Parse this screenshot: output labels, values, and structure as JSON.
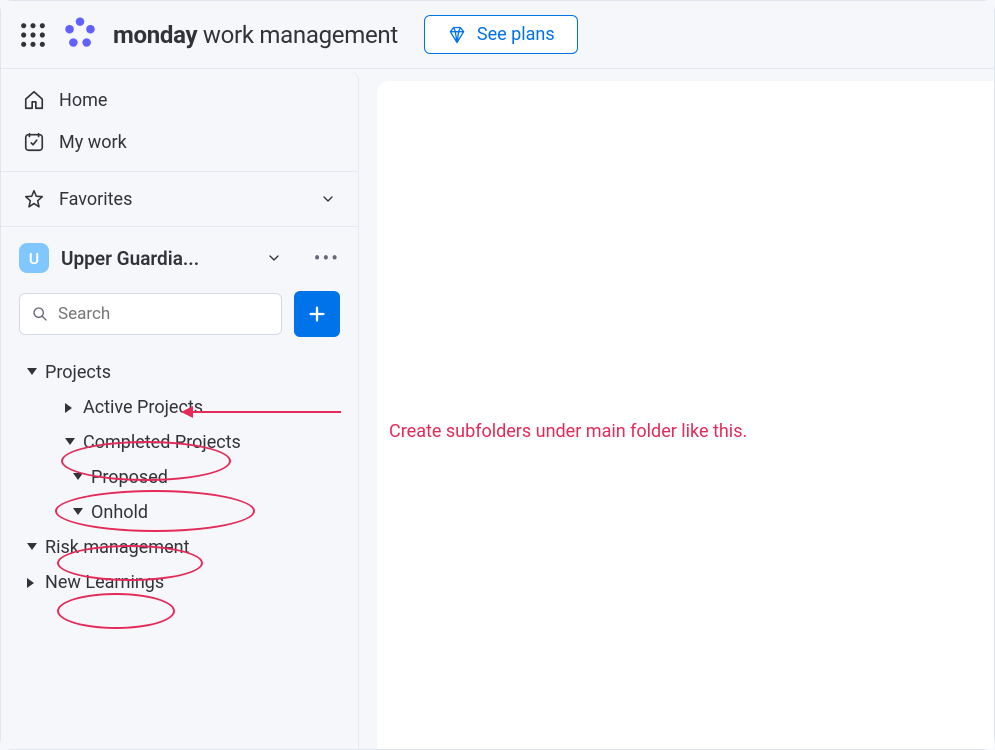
{
  "header": {
    "product_bold": "monday",
    "product_light": " work management",
    "see_plans_label": "See plans"
  },
  "sidebar": {
    "nav": {
      "home": "Home",
      "my_work": "My work"
    },
    "favorites_label": "Favorites",
    "workspace": {
      "badge_letter": "U",
      "name": "Upper Guardia...",
      "search_placeholder": "Search"
    },
    "tree": {
      "projects": "Projects",
      "active": "Active Projects",
      "completed": "Completed Projects",
      "proposed": "Proposed",
      "onhold": "Onhold",
      "risk": "Risk management",
      "new_learnings": "New Learnings"
    }
  },
  "annotation": {
    "text": "Create subfolders under main folder like this."
  }
}
